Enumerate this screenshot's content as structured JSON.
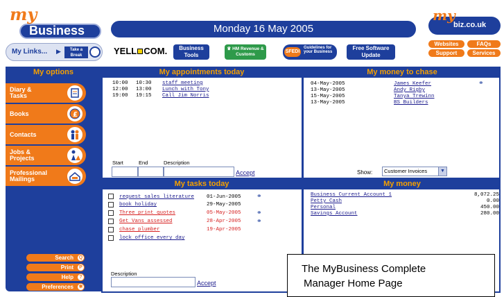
{
  "header": {
    "logo_my": "my",
    "logo_text": "Business",
    "date": "Monday 16 May 2005",
    "site_logo_my": "my",
    "site_logo_text": "biz.co.uk"
  },
  "toolbar": {
    "my_links": "My Links...",
    "take_a_break": "Take a Break",
    "yell_left": "YELL",
    "yell_right": "COM.",
    "business_tools": "Business Tools",
    "hmrc": "HM Revenue & Customs",
    "sfedi": "SFEDI",
    "sfedi_sub": "Guidelines for your Business",
    "free_software": "Free Software Update",
    "websites": "Websites",
    "faqs": "FAQs",
    "support": "Support",
    "services": "Services"
  },
  "sidebar": {
    "title": "My options",
    "items": [
      {
        "label": "Diary & Tasks",
        "icon": "calendar-icon"
      },
      {
        "label": "Books",
        "icon": "pound-coin-icon"
      },
      {
        "label": "Contacts",
        "icon": "people-icon"
      },
      {
        "label": "Jobs & Projects",
        "icon": "worker-icon"
      },
      {
        "label": "Professional Mailings",
        "icon": "mailbox-icon"
      }
    ],
    "bottom": [
      {
        "label": "Search",
        "icon": "search-icon",
        "glyph": "Q"
      },
      {
        "label": "Print",
        "icon": "print-icon",
        "glyph": "P"
      },
      {
        "label": "Help",
        "icon": "help-icon",
        "glyph": "?"
      },
      {
        "label": "Preferences",
        "icon": "preferences-icon",
        "glyph": "✱"
      }
    ]
  },
  "appointments": {
    "title": "My appointments today",
    "rows": [
      {
        "start": "10:00",
        "end": "10:30",
        "desc": "staff meeting"
      },
      {
        "start": "12:00",
        "end": "13:00",
        "desc": "Lunch with Tony"
      },
      {
        "start": "19:00",
        "end": "19:15",
        "desc": "Call Jim Norris"
      }
    ],
    "start_label": "Start",
    "end_label": "End",
    "desc_label": "Description",
    "accept": "Accept"
  },
  "money_to_chase": {
    "title": "My money to chase",
    "rows": [
      {
        "date": "04-May-2005",
        "name": "James Keefer"
      },
      {
        "date": "13-May-2005",
        "name": "Andy Rigby"
      },
      {
        "date": "15-May-2005",
        "name": "Tanya Trewinn"
      },
      {
        "date": "13-May-2005",
        "name": "BS Builders"
      }
    ],
    "show_label": "Show:",
    "show_value": "Customer Invoices"
  },
  "tasks": {
    "title": "My tasks today",
    "rows": [
      {
        "task": "request sales literature",
        "date": "01-Jun-2005",
        "overdue": false
      },
      {
        "task": "book holiday",
        "date": "29-May-2005",
        "overdue": false
      },
      {
        "task": "Three print quotes",
        "date": "05-May-2005",
        "overdue": true
      },
      {
        "task": "Get Vans assessed",
        "date": "28-Apr-2005",
        "overdue": true
      },
      {
        "task": "chase plumber",
        "date": "19-Apr-2005",
        "overdue": true
      },
      {
        "task": "lock office every day",
        "date": "",
        "overdue": false
      }
    ],
    "desc_label": "Description",
    "accept": "Accept"
  },
  "money": {
    "title": "My money",
    "accounts": [
      {
        "name": "Business Current Account 1",
        "balance": "8,072.25"
      },
      {
        "name": "Petty Cash",
        "balance": "0.00"
      },
      {
        "name": "Personal",
        "balance": "450.00"
      },
      {
        "name": "Savings Account",
        "balance": "280.00"
      }
    ]
  },
  "caption": {
    "line1": "The MyBusiness Complete",
    "line2": "Manager Home Page"
  },
  "colors": {
    "brand_blue": "#1e3f9c",
    "accent_orange": "#f07a1a",
    "header_gold": "#f5a000",
    "overdue_red": "#d62020"
  }
}
